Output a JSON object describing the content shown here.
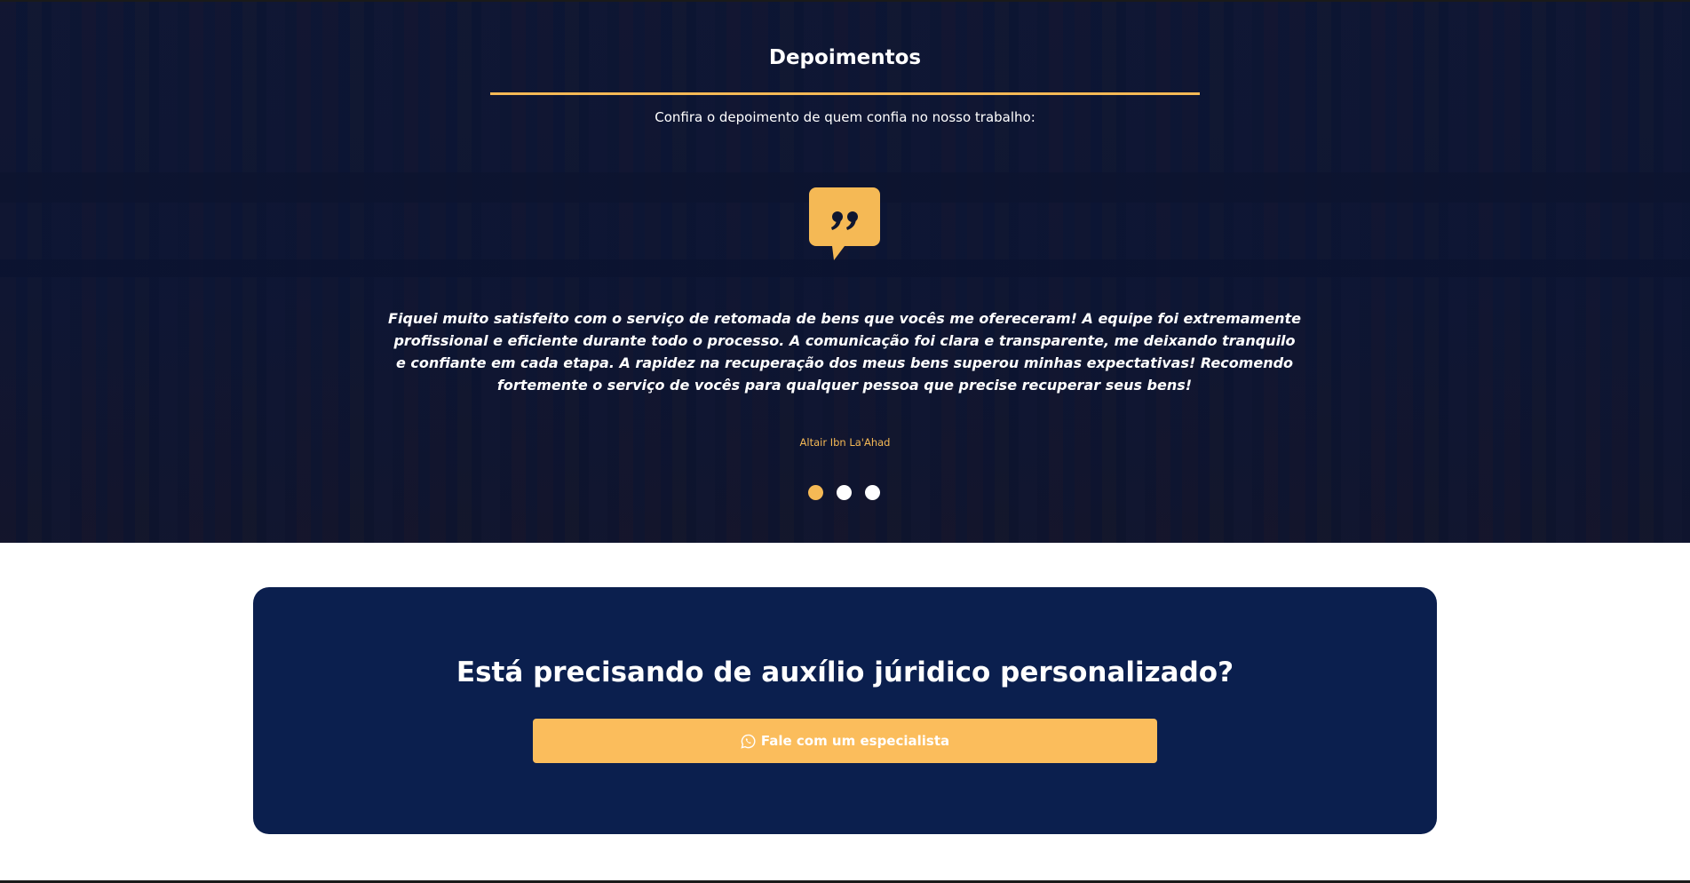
{
  "testimonials": {
    "title": "Depoimentos",
    "subtitle": "Confira o depoimento de quem confia no nosso trabalho:",
    "quote_icon": "quote-bubble-icon",
    "current": {
      "text": "Fiquei muito satisfeito com o serviço de retomada de bens que vocês me ofereceram! A equipe foi extremamente profissional e eficiente durante todo o processo. A comunicação foi clara e transparente, me deixando tranquilo e confiante em cada etapa. A rapidez na recuperação dos meus bens superou minhas expectativas! Recomendo fortemente o serviço de vocês para qualquer pessoa que precise recuperar seus bens!",
      "author": "Altair Ibn La'Ahad"
    },
    "slides_total": 3,
    "active_slide": 1
  },
  "cta": {
    "title": "Está precisando de auxílio júridico personalizado?",
    "button_label": "Fale com um especialista",
    "button_icon": "whatsapp-icon"
  },
  "colors": {
    "accent": "#f5b955",
    "navy": "#0b1f4e",
    "button": "#fbbd5c"
  }
}
